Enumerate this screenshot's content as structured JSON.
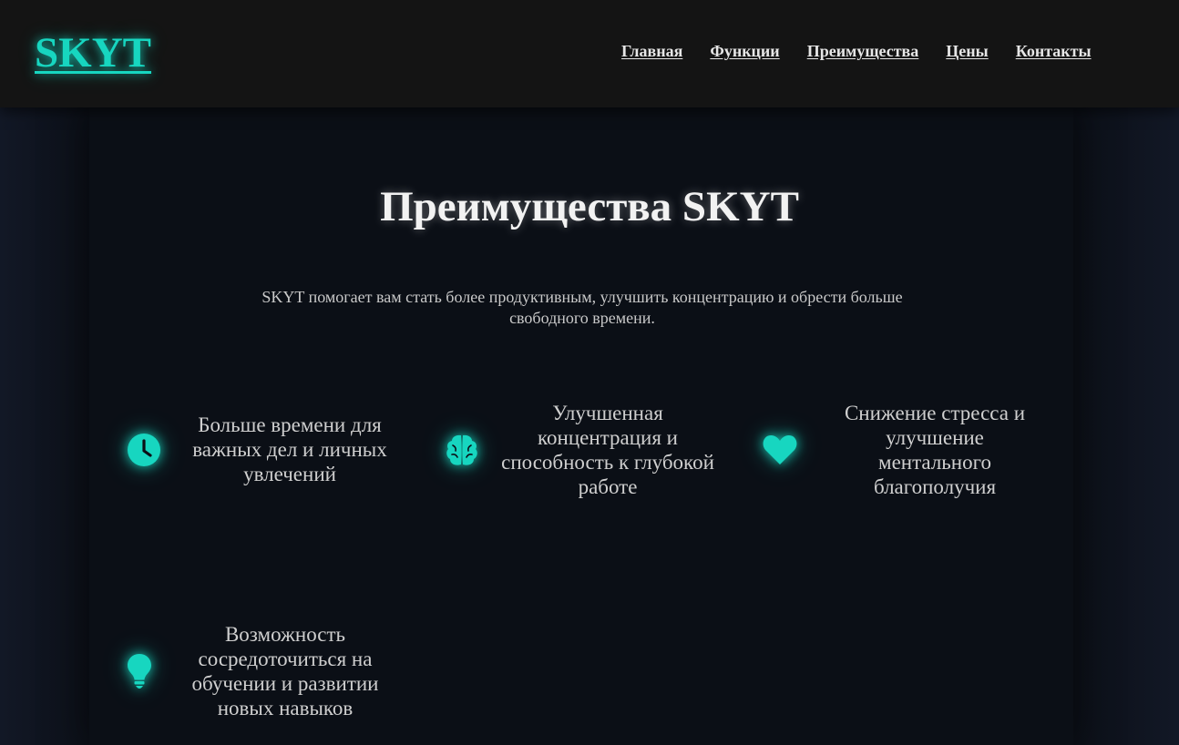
{
  "header": {
    "logo": "SKYT",
    "nav": [
      "Главная",
      "Функции",
      "Преимущества",
      "Цены",
      "Контакты"
    ]
  },
  "main": {
    "title": "Преимущества SKYT",
    "subtitle": "SKYT помогает вам стать более продуктивным, улучшить концентрацию и обрести больше свободного времени.",
    "features": [
      {
        "icon": "clock-icon",
        "text": "Больше времени для важных дел и личных увлечений"
      },
      {
        "icon": "brain-icon",
        "text": "Улучшенная концентрация и способность к глубокой работе"
      },
      {
        "icon": "heart-icon",
        "text": "Снижение стресса и улучшение ментального благополучия"
      },
      {
        "icon": "lightbulb-icon",
        "text": "Возможность сосредоточиться на обучении и развитии новых навыков"
      }
    ]
  },
  "colors": {
    "accent": "#17d6c0",
    "header_bg": "#141414",
    "page_bg": "#0b0f16"
  }
}
